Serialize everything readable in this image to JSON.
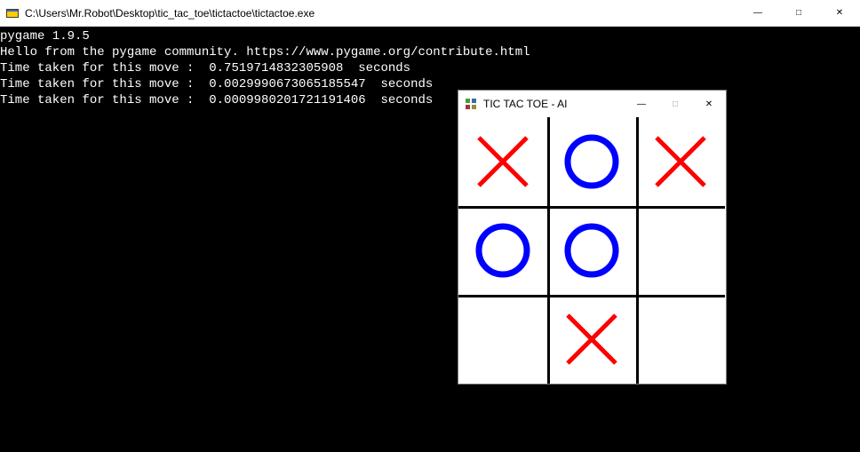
{
  "console": {
    "title": "C:\\Users\\Mr.Robot\\Desktop\\tic_tac_toe\\tictactoe\\tictactoe.exe",
    "lines": [
      "pygame 1.9.5",
      "Hello from the pygame community. https://www.pygame.org/contribute.html",
      "Time taken for this move :  0.7519714832305908  seconds",
      "Time taken for this move :  0.0029990673065185547  seconds",
      "Time taken for this move :  0.0009980201721191406  seconds"
    ],
    "controls": {
      "min": "—",
      "max": "□",
      "close": "✕"
    }
  },
  "game": {
    "title": "TIC TAC TOE - AI",
    "controls": {
      "min": "—",
      "max": "□",
      "close": "✕"
    },
    "board": [
      [
        "X",
        "O",
        "X"
      ],
      [
        "O",
        "O",
        ""
      ],
      [
        "",
        "X",
        ""
      ]
    ]
  }
}
